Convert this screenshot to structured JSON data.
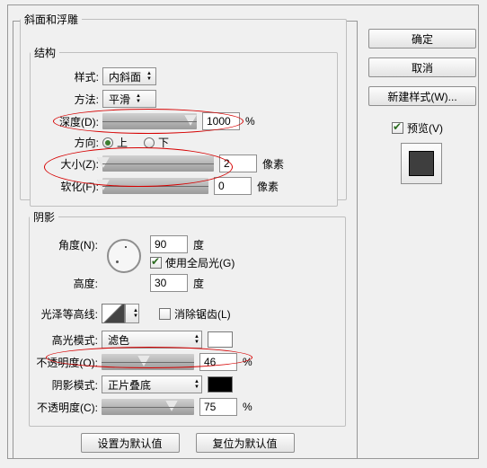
{
  "groups": {
    "bevel": "斜面和浮雕",
    "struct": "结构",
    "shadow": "阴影"
  },
  "struct": {
    "style_lbl": "样式:",
    "style_val": "内斜面",
    "method_lbl": "方法:",
    "method_val": "平滑",
    "depth_lbl": "深度(D):",
    "depth_val": "1000",
    "depth_unit": "%",
    "dir_lbl": "方向:",
    "dir_up": "上",
    "dir_down": "下",
    "size_lbl": "大小(Z):",
    "size_val": "2",
    "size_unit": "像素",
    "soft_lbl": "软化(F):",
    "soft_val": "0",
    "soft_unit": "像素"
  },
  "shadow": {
    "angle_lbl": "角度(N):",
    "angle_val": "90",
    "angle_unit": "度",
    "global_lbl": "使用全局光(G)",
    "alt_lbl": "高度:",
    "alt_val": "30",
    "alt_unit": "度",
    "contour_lbl": "光泽等高线:",
    "antialias_lbl": "消除锯齿(L)",
    "hlmode_lbl": "高光模式:",
    "hlmode_val": "滤色",
    "hlopac_lbl": "不透明度(O):",
    "hlopac_val": "46",
    "hlopac_unit": "%",
    "shmode_lbl": "阴影模式:",
    "shmode_val": "正片叠底",
    "shopac_lbl": "不透明度(C):",
    "shopac_val": "75",
    "shopac_unit": "%"
  },
  "footer": {
    "default": "设置为默认值",
    "reset": "复位为默认值"
  },
  "side": {
    "ok": "确定",
    "cancel": "取消",
    "newstyle": "新建样式(W)...",
    "preview": "预览(V)"
  }
}
